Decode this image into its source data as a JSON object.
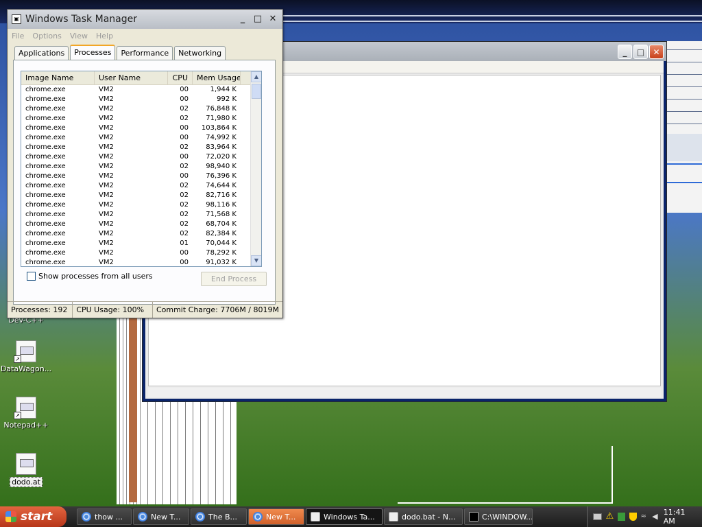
{
  "task_manager": {
    "title": "Windows Task Manager",
    "menu": [
      "File",
      "Options",
      "View",
      "Help"
    ],
    "tabs": [
      "Applications",
      "Processes",
      "Performance",
      "Networking"
    ],
    "active_tab": "Processes",
    "columns": [
      "Image Name",
      "User Name",
      "CPU",
      "Mem Usage"
    ],
    "rows": [
      {
        "image": "chrome.exe",
        "user": "VM2",
        "cpu": "00",
        "mem": "1,944 K"
      },
      {
        "image": "chrome.exe",
        "user": "VM2",
        "cpu": "00",
        "mem": "992 K"
      },
      {
        "image": "chrome.exe",
        "user": "VM2",
        "cpu": "02",
        "mem": "76,848 K"
      },
      {
        "image": "chrome.exe",
        "user": "VM2",
        "cpu": "02",
        "mem": "71,980 K"
      },
      {
        "image": "chrome.exe",
        "user": "VM2",
        "cpu": "00",
        "mem": "103,864 K"
      },
      {
        "image": "chrome.exe",
        "user": "VM2",
        "cpu": "00",
        "mem": "74,992 K"
      },
      {
        "image": "chrome.exe",
        "user": "VM2",
        "cpu": "02",
        "mem": "83,964 K"
      },
      {
        "image": "chrome.exe",
        "user": "VM2",
        "cpu": "00",
        "mem": "72,020 K"
      },
      {
        "image": "chrome.exe",
        "user": "VM2",
        "cpu": "02",
        "mem": "98,940 K"
      },
      {
        "image": "chrome.exe",
        "user": "VM2",
        "cpu": "00",
        "mem": "76,396 K"
      },
      {
        "image": "chrome.exe",
        "user": "VM2",
        "cpu": "02",
        "mem": "74,644 K"
      },
      {
        "image": "chrome.exe",
        "user": "VM2",
        "cpu": "02",
        "mem": "82,716 K"
      },
      {
        "image": "chrome.exe",
        "user": "VM2",
        "cpu": "02",
        "mem": "98,116 K"
      },
      {
        "image": "chrome.exe",
        "user": "VM2",
        "cpu": "02",
        "mem": "71,568 K"
      },
      {
        "image": "chrome.exe",
        "user": "VM2",
        "cpu": "02",
        "mem": "68,704 K"
      },
      {
        "image": "chrome.exe",
        "user": "VM2",
        "cpu": "02",
        "mem": "82,384 K"
      },
      {
        "image": "chrome.exe",
        "user": "VM2",
        "cpu": "01",
        "mem": "70,044 K"
      },
      {
        "image": "chrome.exe",
        "user": "VM2",
        "cpu": "00",
        "mem": "78,292 K"
      },
      {
        "image": "chrome.exe",
        "user": "VM2",
        "cpu": "00",
        "mem": "91,032 K"
      }
    ],
    "show_all_label": "Show processes from all users",
    "show_all_checked": false,
    "end_process_label": "End Process",
    "status": {
      "processes": "Processes: 192",
      "cpu": "CPU Usage: 100%",
      "commit": "Commit Charge: 7706M / 8019M"
    }
  },
  "desktop_icons": [
    {
      "label": "Dev-C++",
      "icon": "devcpp-icon"
    },
    {
      "label": "DataWagon...",
      "icon": "shortcut-icon"
    },
    {
      "label": "Notepad++",
      "icon": "notepadpp-icon"
    },
    {
      "label": "dodo.at",
      "icon": "batch-file-icon"
    }
  ],
  "taskbar": {
    "start_label": "start",
    "tasks": [
      {
        "label": "thow ...",
        "icon": "chrome-icon",
        "style": "normal"
      },
      {
        "label": "New T...",
        "icon": "chrome-icon",
        "style": "normal"
      },
      {
        "label": "The B...",
        "icon": "chrome-icon",
        "style": "normal"
      },
      {
        "label": "New T...",
        "icon": "chrome-icon",
        "style": "orange"
      },
      {
        "label": "Windows Ta...",
        "icon": "taskmgr-icon",
        "style": "active"
      },
      {
        "label": "dodo.bat - N...",
        "icon": "notepad-icon",
        "style": "normal"
      },
      {
        "label": "C:\\WINDOW...",
        "icon": "cmd-icon",
        "style": "normal"
      }
    ],
    "clock": "11:41 AM"
  },
  "colors": {
    "accent_tab": "#f2a626",
    "start": "#c84a22"
  }
}
